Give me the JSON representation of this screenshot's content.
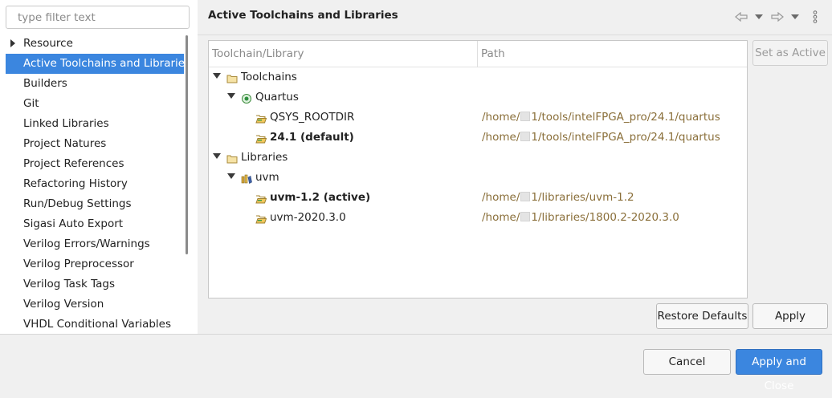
{
  "filter": {
    "placeholder": "type filter text"
  },
  "nav": {
    "items": [
      {
        "label": "Resource",
        "expandable": true
      },
      {
        "label": "Active Toolchains and Libraries",
        "selected": true
      },
      {
        "label": "Builders"
      },
      {
        "label": "Git"
      },
      {
        "label": "Linked Libraries"
      },
      {
        "label": "Project Natures"
      },
      {
        "label": "Project References"
      },
      {
        "label": "Refactoring History"
      },
      {
        "label": "Run/Debug Settings"
      },
      {
        "label": "Sigasi Auto Export"
      },
      {
        "label": "Verilog Errors/Warnings"
      },
      {
        "label": "Verilog Preprocessor"
      },
      {
        "label": "Verilog Task Tags"
      },
      {
        "label": "Verilog Version"
      },
      {
        "label": "VHDL Conditional Variables"
      }
    ]
  },
  "page": {
    "title": "Active Toolchains and Libraries"
  },
  "toolbar": {
    "back_icon": "back-arrow-icon",
    "back_menu_icon": "chevron-down-icon",
    "forward_icon": "forward-arrow-icon",
    "forward_menu_icon": "chevron-down-icon",
    "menu_icon": "vertical-ellipsis-icon"
  },
  "table": {
    "columns": [
      "Toolchain/Library",
      "Path"
    ],
    "rows": [
      {
        "label": "Toolchains",
        "level": 0,
        "expanded": true,
        "icon": "folder-icon",
        "bold": false,
        "path": ""
      },
      {
        "label": "Quartus",
        "level": 1,
        "expanded": true,
        "icon": "toolchain-icon",
        "bold": false,
        "path": ""
      },
      {
        "label": "QSYS_ROOTDIR",
        "level": 2,
        "icon": "open-folder-icon",
        "bold": false,
        "path": "/home/▯1/tools/intelFPGA_pro/24.1/quartus"
      },
      {
        "label": "24.1 (default)",
        "level": 2,
        "icon": "open-folder-icon",
        "bold": true,
        "path": "/home/▯1/tools/intelFPGA_pro/24.1/quartus"
      },
      {
        "label": "Libraries",
        "level": 0,
        "expanded": true,
        "icon": "folder-icon",
        "bold": false,
        "path": ""
      },
      {
        "label": "uvm",
        "level": 1,
        "expanded": true,
        "icon": "library-icon",
        "bold": false,
        "path": ""
      },
      {
        "label": "uvm-1.2 (active)",
        "level": 2,
        "icon": "open-folder-icon",
        "bold": true,
        "path": "/home/▯1/libraries/uvm-1.2"
      },
      {
        "label": "uvm-2020.3.0",
        "level": 2,
        "icon": "open-folder-icon",
        "bold": false,
        "path": "/home/▯1/libraries/1800.2-2020.3.0"
      }
    ]
  },
  "buttons": {
    "set_active": "Set as Active",
    "restore_defaults": "Restore Defaults",
    "apply": "Apply",
    "cancel": "Cancel",
    "apply_close": "Apply and Close"
  },
  "colors": {
    "accent": "#3b86df",
    "path_text": "#8a6f3a",
    "background": "#f0f0f0"
  }
}
